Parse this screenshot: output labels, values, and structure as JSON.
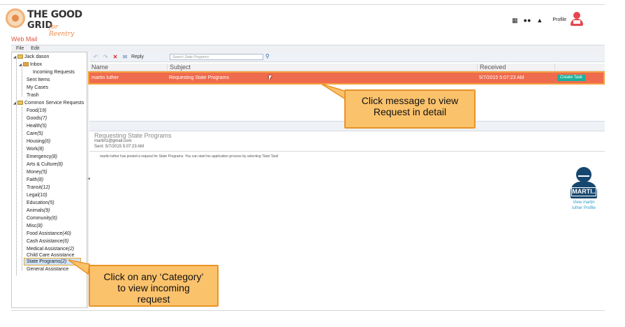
{
  "header": {
    "logo_line1": "THE GOOD",
    "logo_line2": "GRID",
    "logo_tagline": "for Reentry",
    "icons": [
      "apps-grid-icon",
      "users-icon",
      "bell-icon"
    ],
    "profile_label": "Profile"
  },
  "app_title": "Web Mail",
  "menubar": {
    "file": "File",
    "edit": "Edit"
  },
  "tree": {
    "root": "Jack dason",
    "inbox": "Inbox",
    "incoming": "Incoming Requests",
    "sent": "Sent Items",
    "my_cases": "My Cases",
    "trash": "Trash",
    "common": "Common Service Requests",
    "categories": [
      {
        "name": "Food",
        "count": "(19)"
      },
      {
        "name": "Goods",
        "count": "(7)"
      },
      {
        "name": "Health",
        "count": "(5)"
      },
      {
        "name": "Care",
        "count": "(5)"
      },
      {
        "name": "Housing",
        "count": "(6)"
      },
      {
        "name": "Work",
        "count": "(8)"
      },
      {
        "name": "Emergency",
        "count": "(8)"
      },
      {
        "name": "Arts & Culture",
        "count": "(8)"
      },
      {
        "name": "Money",
        "count": "(5)"
      },
      {
        "name": "Faith",
        "count": "(8)"
      },
      {
        "name": "Transit",
        "count": "(12)"
      },
      {
        "name": "Legal",
        "count": "(10)"
      },
      {
        "name": "Education",
        "count": "(5)"
      },
      {
        "name": "Animals",
        "count": "(9)"
      },
      {
        "name": "Community",
        "count": "(6)"
      },
      {
        "name": "Misc",
        "count": "(8)"
      },
      {
        "name": "Food Assistance",
        "count": "(40)"
      },
      {
        "name": "Cash Assistance",
        "count": "(6)"
      },
      {
        "name": "Medical Assistance",
        "count": "(2)"
      },
      {
        "name": "Child Care Assistance",
        "count": ""
      },
      {
        "name": "State Programs",
        "count": "(2)"
      },
      {
        "name": "General Assistance",
        "count": ""
      }
    ]
  },
  "toolbar": {
    "reply_label": "Reply",
    "search_placeholder": "Search State Programs"
  },
  "grid": {
    "columns": [
      "Name",
      "Subject",
      "Received"
    ],
    "rows": [
      {
        "name": "martin luther",
        "subject": "Requesting State Programs",
        "received": "5/7/2015 5:07:23 AM",
        "action": "Create Task"
      }
    ]
  },
  "preview": {
    "subject": "Requesting State Programs",
    "email": "martin1@gmail.com",
    "sent": "Sent: 5/7/2015 5:07:23 AM",
    "body": "martin luther has posted a request for State Programs. You can start his application process by selecting 'Start Task'"
  },
  "user_card": {
    "label": "MARTI..",
    "link_line1": "View martin",
    "link_line2": "luther Profile"
  },
  "callouts": {
    "message_line1": "Click message to view",
    "message_line2": "Request in detail",
    "category_line1": "Click on any ‘Category’",
    "category_line2": "to view incoming",
    "category_line3": "request"
  },
  "colors": {
    "accent": "#e0543c",
    "selected_row": "#ef6b4e",
    "highlight_border": "#f4a23e",
    "callout_fill": "#fbc26c",
    "task_button": "#1cb09a",
    "user_card": "#16476f"
  }
}
